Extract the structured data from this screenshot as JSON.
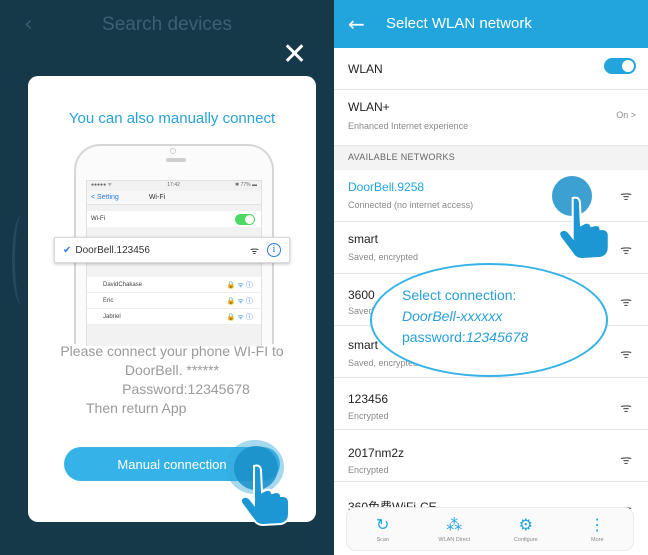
{
  "left": {
    "back_icon": "chevron-left-icon",
    "title": "Search devices",
    "close_glyph": "✕",
    "dialog": {
      "title": "You can also manually connect",
      "phone": {
        "status_left": "●●●●● ᯤ",
        "status_mid": "17:42",
        "status_right": "✱ 77% ▬",
        "nav_back": "< Setting",
        "nav_title": "Wi-Fi",
        "wifi_label": "Wi-Fi",
        "networks": [
          {
            "name": "DavidChakase",
            "sig": "🔒 ᯤ ⓘ"
          },
          {
            "name": "Eric",
            "sig": "🔒 ᯤ ⓘ"
          },
          {
            "name": "Jabriel",
            "sig": "🔒 ᯤ ⓘ"
          }
        ]
      },
      "selected_network": "DoorBell.123456",
      "instructions": {
        "line1": "Please connect your phone WI-FI to",
        "line2": "DoorBell. ******",
        "line3": "Password:12345678",
        "line4": "Then return App"
      },
      "manual_button": "Manual connection"
    }
  },
  "right": {
    "header_title": "Select WLAN network",
    "wlan_label": "WLAN",
    "wlan_enabled": true,
    "wlanplus_label": "WLAN+",
    "wlanplus_sub": "Enhanced Internet experience",
    "wlanplus_value": "On  >",
    "section_title": "AVAILABLE NETWORKS",
    "networks": [
      {
        "name": "DoorBell.9258",
        "sub": "Connected (no internet access)"
      },
      {
        "name": "smart",
        "sub": "Saved, encrypted"
      },
      {
        "name": "3600",
        "sub": "Saved"
      },
      {
        "name": "smart",
        "sub": "Saved, encrypted"
      },
      {
        "name": "123456",
        "sub": "Encrypted"
      },
      {
        "name": "2017nm2z",
        "sub": "Encrypted"
      },
      {
        "name": "360免费WiFi-CE",
        "sub": ""
      }
    ],
    "bubble": {
      "line1": "Select connection:",
      "line2": "DoorBell-xxxxxx",
      "line3_prefix": "password:",
      "line3_value": "12345678"
    },
    "bottom_bar": [
      {
        "icon": "refresh-icon",
        "glyph": "↻",
        "label": "Scan"
      },
      {
        "icon": "wlan-direct-icon",
        "glyph": "⁂",
        "label": "WLAN Direct"
      },
      {
        "icon": "configure-gear-icon",
        "glyph": "⚙",
        "label": "Configure"
      },
      {
        "icon": "more-vertical-icon",
        "glyph": "⋮",
        "label": "More"
      }
    ]
  },
  "colors": {
    "left_bg": "#16394a",
    "accent": "#22a5dd",
    "button": "#35b3e8"
  }
}
